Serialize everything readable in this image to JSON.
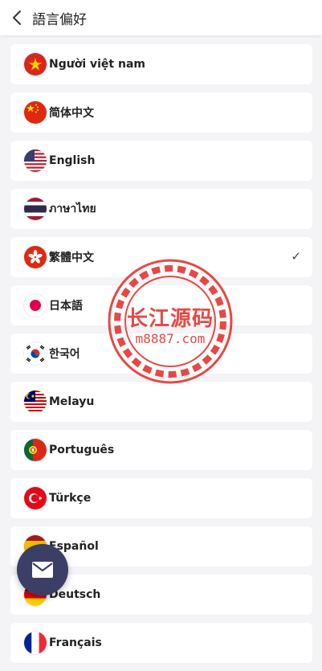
{
  "header": {
    "title": "語言偏好"
  },
  "languages": [
    {
      "label": "Người việt nam",
      "flag": "vietnam-flag-icon"
    },
    {
      "label": "简体中文",
      "flag": "china-flag-icon"
    },
    {
      "label": "English",
      "flag": "usa-flag-icon"
    },
    {
      "label": "ภาษาไทย",
      "flag": "thailand-flag-icon"
    },
    {
      "label": "繁體中文",
      "flag": "hong-kong-flag-icon",
      "selected": true,
      "check": "✓"
    },
    {
      "label": "日本語",
      "flag": "japan-flag-icon"
    },
    {
      "label": "한국어",
      "flag": "korea-flag-icon"
    },
    {
      "label": "Melayu",
      "flag": "malaysia-flag-icon"
    },
    {
      "label": "Português",
      "flag": "portugal-flag-icon"
    },
    {
      "label": "Türkçe",
      "flag": "turkey-flag-icon"
    },
    {
      "label": "Español",
      "flag": "spain-flag-icon"
    },
    {
      "label": "Deutsch",
      "flag": "germany-flag-icon"
    },
    {
      "label": "Français",
      "flag": "france-flag-icon"
    }
  ],
  "watermark": {
    "title": "长江源码",
    "subtitle": "m8887.com",
    "color": "#e53935"
  },
  "fab": {
    "icon": "mail-icon"
  },
  "colors": {
    "background": "#f4f4f6",
    "fab": "#3b3f66"
  }
}
